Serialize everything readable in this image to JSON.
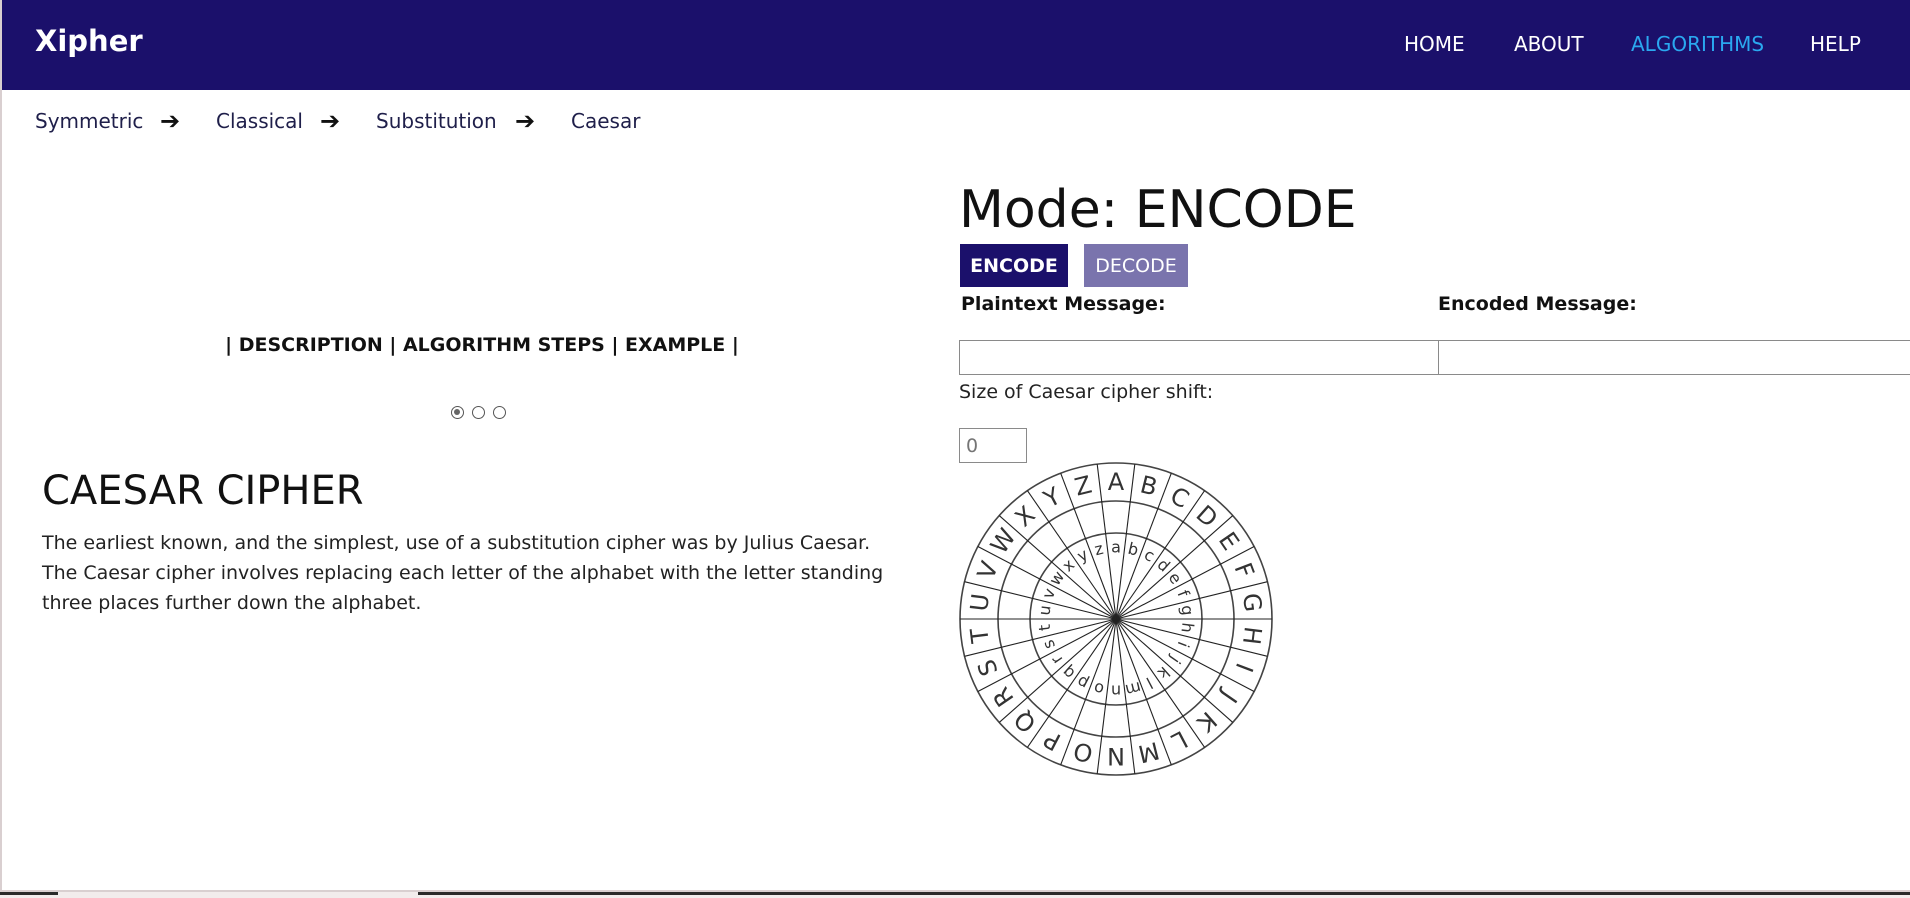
{
  "nav": {
    "brand": "Xipher",
    "links": [
      "HOME",
      "ABOUT",
      "ALGORITHMS",
      "HELP"
    ],
    "active": "ALGORITHMS",
    "active_color": "#2aa8f0",
    "bar_color": "#1b106b"
  },
  "breadcrumb": [
    "Symmetric",
    "Classical",
    "Substitution",
    "Caesar"
  ],
  "info_tabs": [
    "DESCRIPTION",
    "ALGORITHM STEPS",
    "EXAMPLE"
  ],
  "carousel": {
    "count": 3,
    "active_index": 0
  },
  "cipher": {
    "title": "CAESAR CIPHER",
    "description": "The earliest known, and the simplest, use of a substitution cipher was by Julius Caesar. The Caesar cipher involves replacing each letter of the alphabet with the letter standing three places further down the alphabet."
  },
  "tool": {
    "mode_title": "Mode: ENCODE",
    "encode_label": "ENCODE",
    "decode_label": "DECODE",
    "plaintext_label": "Plaintext Message:",
    "encoded_label": "Encoded Message:",
    "plaintext_value": "",
    "encoded_value": "",
    "shift_label": "Size of Caesar cipher shift:",
    "shift_placeholder": "0"
  },
  "wheel": {
    "outer_letters": [
      "A",
      "B",
      "C",
      "D",
      "E",
      "F",
      "G",
      "H",
      "I",
      "J",
      "K",
      "L",
      "M",
      "N",
      "O",
      "P",
      "Q",
      "R",
      "S",
      "T",
      "U",
      "V",
      "W",
      "X",
      "Y",
      "Z"
    ],
    "inner_letters": [
      "a",
      "b",
      "c",
      "d",
      "e",
      "f",
      "g",
      "h",
      "i",
      "j",
      "k",
      "l",
      "m",
      "n",
      "o",
      "p",
      "q",
      "r",
      "s",
      "t",
      "u",
      "v",
      "w",
      "x",
      "y",
      "z"
    ],
    "shift": 0
  }
}
